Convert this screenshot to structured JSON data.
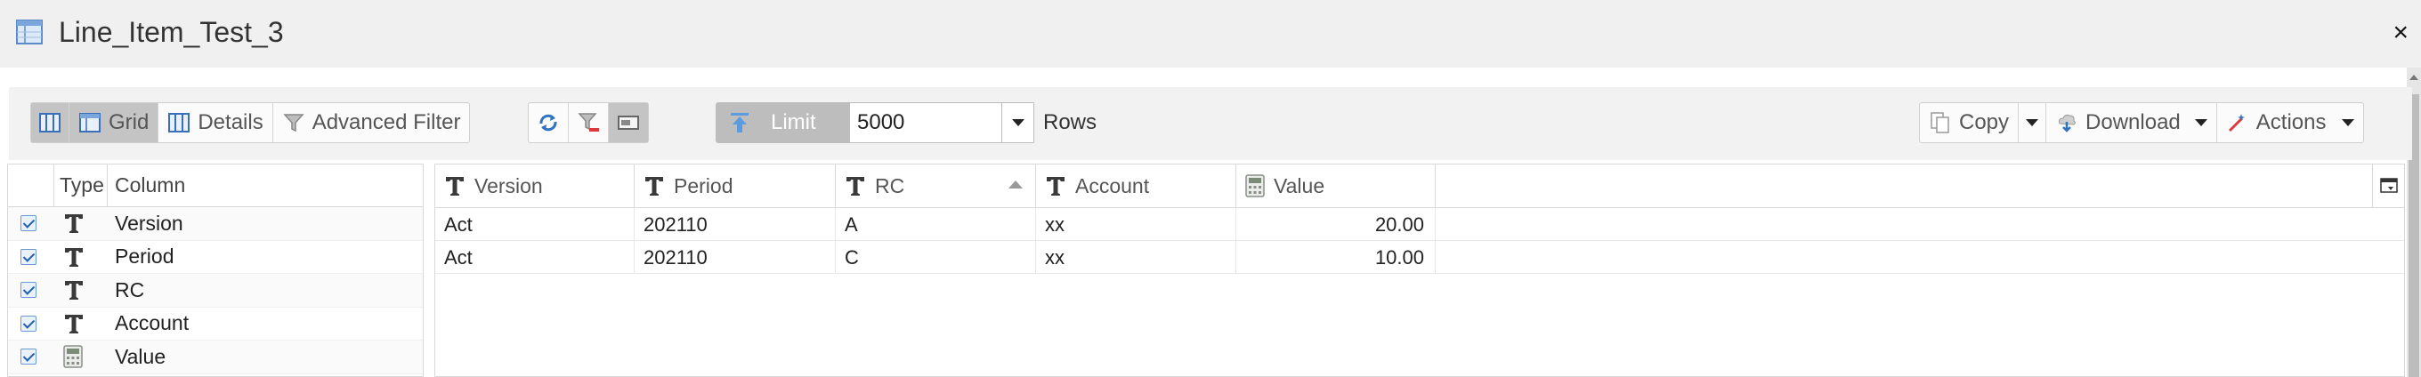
{
  "window": {
    "title": "Line_Item_Test_3",
    "close_glyph": "×"
  },
  "toolbar": {
    "view_buttons": [
      "Grid",
      "Details",
      "Advanced Filter"
    ],
    "limit_label": "Limit",
    "limit_value": "5000",
    "rows_label": "Rows",
    "copy_label": "Copy",
    "download_label": "Download",
    "actions_label": "Actions"
  },
  "column_panel": {
    "headers": {
      "type": "Type",
      "column": "Column"
    },
    "rows": [
      {
        "name": "Version",
        "type_icon": "text-type-icon"
      },
      {
        "name": "Period",
        "type_icon": "text-type-icon"
      },
      {
        "name": "RC",
        "type_icon": "text-type-icon"
      },
      {
        "name": "Account",
        "type_icon": "text-type-icon"
      },
      {
        "name": "Value",
        "type_icon": "calculator-icon"
      }
    ]
  },
  "grid": {
    "columns": [
      "Version",
      "Period",
      "RC",
      "Account",
      "Value"
    ],
    "sorted_column": "RC",
    "sort_direction": "ascending",
    "rows": [
      [
        "Act",
        "202110",
        "A",
        "xx",
        "20.00"
      ],
      [
        "Act",
        "202110",
        "C",
        "xx",
        "10.00"
      ]
    ]
  },
  "colors": {
    "active_button": "#c4c4c4",
    "limit_button": "#bdbdbd",
    "checkbox_accent": "#1f5fb4"
  }
}
